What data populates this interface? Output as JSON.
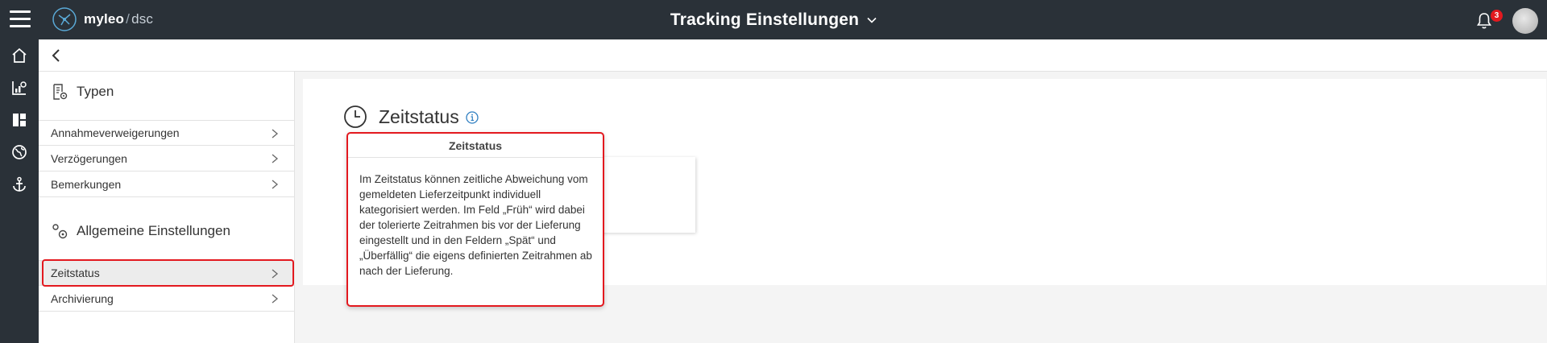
{
  "header": {
    "app_brand": "myleo",
    "app_sub": "dsc",
    "page_title": "Tracking Einstellungen",
    "notification_count": "3"
  },
  "rail": {
    "items": [
      "home-icon",
      "chart-icon",
      "dashboard-icon",
      "globe-icon",
      "anchor-icon"
    ]
  },
  "sidebar": {
    "section_types": {
      "title": "Typen",
      "items": [
        {
          "label": "Annahmeverweigerungen"
        },
        {
          "label": "Verzögerungen"
        },
        {
          "label": "Bemerkungen"
        }
      ]
    },
    "section_general": {
      "title": "Allgemeine Einstellungen",
      "items": [
        {
          "label": "Zeitstatus",
          "selected": true
        },
        {
          "label": "Archivierung"
        }
      ]
    }
  },
  "main": {
    "title": "Zeitstatus"
  },
  "tooltip": {
    "title": "Zeitstatus",
    "body": "Im Zeitstatus können zeitliche Abweichung vom gemeldeten Lieferzeitpunkt individuell kategorisiert werden. Im Feld „Früh“ wird dabei der tolerierte Zeitrahmen bis vor der Lieferung eingestellt und in den Feldern „Spät“ und „Überfällig“ die eigens definierten Zeitrahmen ab nach der Lieferung."
  },
  "colors": {
    "topbar": "#2a3138",
    "highlight": "#e3191f",
    "badge": "#e3191f"
  }
}
